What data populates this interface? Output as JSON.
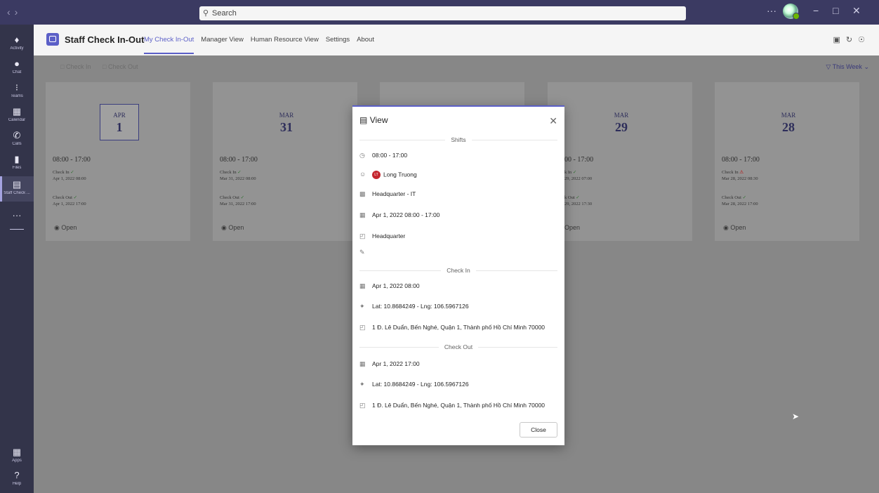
{
  "titlebar": {
    "search_placeholder": "Search",
    "more_label": "···",
    "minimize_label": "−",
    "maximize_label": "□",
    "close_label": "✕"
  },
  "rail": [
    {
      "label": "Activity",
      "icon": "bell-icon"
    },
    {
      "label": "Chat",
      "icon": "chat-icon"
    },
    {
      "label": "Teams",
      "icon": "teams-icon"
    },
    {
      "label": "Calendar",
      "icon": "calendar-icon"
    },
    {
      "label": "Calls",
      "icon": "phone-icon"
    },
    {
      "label": "Files",
      "icon": "file-icon"
    },
    {
      "label": "Staff Check ...",
      "icon": "staff-check-icon"
    },
    {
      "label": "···",
      "icon": "more-icon"
    },
    {
      "label": "Apps",
      "icon": "apps-icon"
    },
    {
      "label": "Help",
      "icon": "help-icon"
    }
  ],
  "app": {
    "title": "Staff Check In-Out",
    "tabs": [
      "My Check In-Out",
      "Manager View",
      "Human Resource View",
      "Settings",
      "About"
    ],
    "active_tab": "My Check In-Out",
    "accent": "#5b5fc7"
  },
  "toolbar": {
    "check_in": "Check In",
    "check_out": "Check Out",
    "filter": "This Week"
  },
  "cards": [
    {
      "mon": "APR",
      "day": "1",
      "shift": "08:00 - 17:00",
      "ci_label": "Check In",
      "ci_time": "Apr 1, 2022 08:00",
      "co_label": "Check Out",
      "co_time": "Apr 1, 2022 17:00",
      "open": "Open"
    },
    {
      "mon": "MAR",
      "day": "31",
      "shift": "08:00 - 17:00",
      "ci_label": "Check In",
      "ci_time": "Mar 31, 2022 08:00",
      "co_label": "Check Out",
      "co_time": "Mar 31, 2022 17:00",
      "open": "Open"
    },
    {
      "mon": "MAR",
      "day": "29",
      "shift": "00 - 17:00",
      "ci_label": "k In",
      "ci_time": "29, 2022 07:00",
      "co_label": "k Out",
      "co_time": "29, 2022 17:30",
      "open": "Open"
    },
    {
      "mon": "MAR",
      "day": "28",
      "shift": "08:00 - 17:00",
      "ci_label": "Check In",
      "ci_time": "Mar 28, 2022 08:30",
      "co_label": "Check Out",
      "co_time": "Mar 28, 2022 17:00",
      "open": "Open"
    }
  ],
  "modal": {
    "title": "View",
    "shifts_header": "Shifts",
    "shift_time": "08:00 - 17:00",
    "user_initials": "LT",
    "user_name": "Long Truong",
    "department": "Headquarter - IT",
    "date_range": "Apr 1, 2022 08:00 - 17:00",
    "location": "Headquarter",
    "checkin_header": "Check In",
    "checkin_time": "Apr 1, 2022 08:00",
    "checkin_coords": "Lat: 10.8684249 - Lng: 106.5967126",
    "checkin_address": "1 Đ. Lê Duẩn, Bến Nghé, Quận 1, Thành phố Hồ Chí Minh 70000",
    "checkout_header": "Check Out",
    "checkout_time": "Apr 1, 2022 17:00",
    "checkout_coords": "Lat: 10.8684249 - Lng: 106.5967126",
    "checkout_address": "1 Đ. Lê Duẩn, Bến Nghé, Quận 1, Thành phố Hồ Chí Minh 70000",
    "close_button": "Close"
  }
}
